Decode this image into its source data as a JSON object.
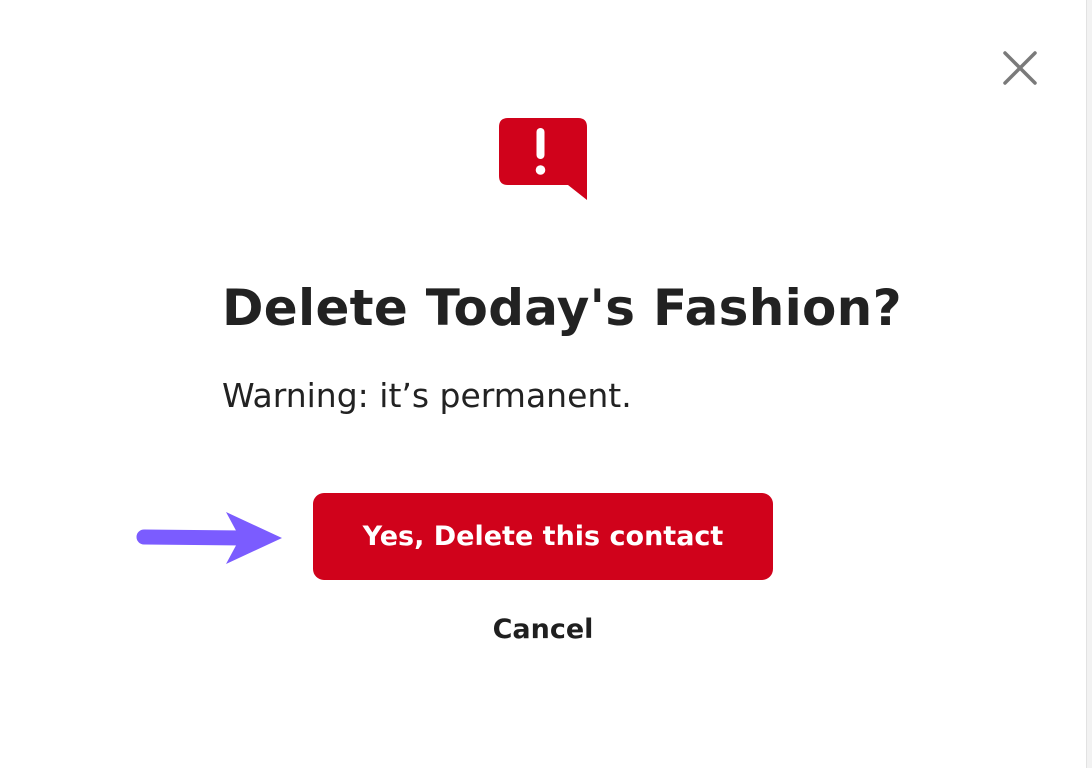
{
  "dialog": {
    "title": "Delete Today's Fashion?",
    "warning": "Warning: it’s permanent.",
    "confirm_label": "Yes, Delete this contact",
    "cancel_label": "Cancel",
    "close_icon": "close-icon",
    "alert_icon": "alert-speech-bubble-icon",
    "pointer_icon": "arrow-right-icon"
  },
  "colors": {
    "accent": "#d0021b",
    "text": "#222222",
    "close_icon": "#7a7a7a",
    "pointer_arrow": "#7b5cff"
  }
}
